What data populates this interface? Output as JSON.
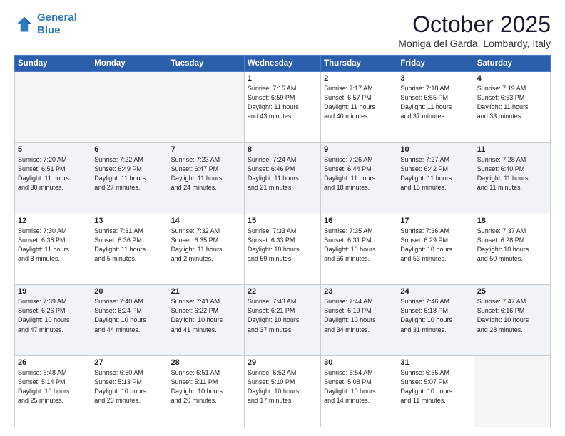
{
  "header": {
    "logo_line1": "General",
    "logo_line2": "Blue",
    "month": "October 2025",
    "location": "Moniga del Garda, Lombardy, Italy"
  },
  "weekdays": [
    "Sunday",
    "Monday",
    "Tuesday",
    "Wednesday",
    "Thursday",
    "Friday",
    "Saturday"
  ],
  "weeks": [
    [
      {
        "day": "",
        "info": ""
      },
      {
        "day": "",
        "info": ""
      },
      {
        "day": "",
        "info": ""
      },
      {
        "day": "1",
        "info": "Sunrise: 7:15 AM\nSunset: 6:59 PM\nDaylight: 11 hours\nand 43 minutes."
      },
      {
        "day": "2",
        "info": "Sunrise: 7:17 AM\nSunset: 6:57 PM\nDaylight: 11 hours\nand 40 minutes."
      },
      {
        "day": "3",
        "info": "Sunrise: 7:18 AM\nSunset: 6:55 PM\nDaylight: 11 hours\nand 37 minutes."
      },
      {
        "day": "4",
        "info": "Sunrise: 7:19 AM\nSunset: 6:53 PM\nDaylight: 11 hours\nand 33 minutes."
      }
    ],
    [
      {
        "day": "5",
        "info": "Sunrise: 7:20 AM\nSunset: 6:51 PM\nDaylight: 11 hours\nand 30 minutes."
      },
      {
        "day": "6",
        "info": "Sunrise: 7:22 AM\nSunset: 6:49 PM\nDaylight: 11 hours\nand 27 minutes."
      },
      {
        "day": "7",
        "info": "Sunrise: 7:23 AM\nSunset: 6:47 PM\nDaylight: 11 hours\nand 24 minutes."
      },
      {
        "day": "8",
        "info": "Sunrise: 7:24 AM\nSunset: 6:46 PM\nDaylight: 11 hours\nand 21 minutes."
      },
      {
        "day": "9",
        "info": "Sunrise: 7:26 AM\nSunset: 6:44 PM\nDaylight: 11 hours\nand 18 minutes."
      },
      {
        "day": "10",
        "info": "Sunrise: 7:27 AM\nSunset: 6:42 PM\nDaylight: 11 hours\nand 15 minutes."
      },
      {
        "day": "11",
        "info": "Sunrise: 7:28 AM\nSunset: 6:40 PM\nDaylight: 11 hours\nand 11 minutes."
      }
    ],
    [
      {
        "day": "12",
        "info": "Sunrise: 7:30 AM\nSunset: 6:38 PM\nDaylight: 11 hours\nand 8 minutes."
      },
      {
        "day": "13",
        "info": "Sunrise: 7:31 AM\nSunset: 6:36 PM\nDaylight: 11 hours\nand 5 minutes."
      },
      {
        "day": "14",
        "info": "Sunrise: 7:32 AM\nSunset: 6:35 PM\nDaylight: 11 hours\nand 2 minutes."
      },
      {
        "day": "15",
        "info": "Sunrise: 7:33 AM\nSunset: 6:33 PM\nDaylight: 10 hours\nand 59 minutes."
      },
      {
        "day": "16",
        "info": "Sunrise: 7:35 AM\nSunset: 6:31 PM\nDaylight: 10 hours\nand 56 minutes."
      },
      {
        "day": "17",
        "info": "Sunrise: 7:36 AM\nSunset: 6:29 PM\nDaylight: 10 hours\nand 53 minutes."
      },
      {
        "day": "18",
        "info": "Sunrise: 7:37 AM\nSunset: 6:28 PM\nDaylight: 10 hours\nand 50 minutes."
      }
    ],
    [
      {
        "day": "19",
        "info": "Sunrise: 7:39 AM\nSunset: 6:26 PM\nDaylight: 10 hours\nand 47 minutes."
      },
      {
        "day": "20",
        "info": "Sunrise: 7:40 AM\nSunset: 6:24 PM\nDaylight: 10 hours\nand 44 minutes."
      },
      {
        "day": "21",
        "info": "Sunrise: 7:41 AM\nSunset: 6:22 PM\nDaylight: 10 hours\nand 41 minutes."
      },
      {
        "day": "22",
        "info": "Sunrise: 7:43 AM\nSunset: 6:21 PM\nDaylight: 10 hours\nand 37 minutes."
      },
      {
        "day": "23",
        "info": "Sunrise: 7:44 AM\nSunset: 6:19 PM\nDaylight: 10 hours\nand 34 minutes."
      },
      {
        "day": "24",
        "info": "Sunrise: 7:46 AM\nSunset: 6:18 PM\nDaylight: 10 hours\nand 31 minutes."
      },
      {
        "day": "25",
        "info": "Sunrise: 7:47 AM\nSunset: 6:16 PM\nDaylight: 10 hours\nand 28 minutes."
      }
    ],
    [
      {
        "day": "26",
        "info": "Sunrise: 6:48 AM\nSunset: 5:14 PM\nDaylight: 10 hours\nand 25 minutes."
      },
      {
        "day": "27",
        "info": "Sunrise: 6:50 AM\nSunset: 5:13 PM\nDaylight: 10 hours\nand 23 minutes."
      },
      {
        "day": "28",
        "info": "Sunrise: 6:51 AM\nSunset: 5:11 PM\nDaylight: 10 hours\nand 20 minutes."
      },
      {
        "day": "29",
        "info": "Sunrise: 6:52 AM\nSunset: 5:10 PM\nDaylight: 10 hours\nand 17 minutes."
      },
      {
        "day": "30",
        "info": "Sunrise: 6:54 AM\nSunset: 5:08 PM\nDaylight: 10 hours\nand 14 minutes."
      },
      {
        "day": "31",
        "info": "Sunrise: 6:55 AM\nSunset: 5:07 PM\nDaylight: 10 hours\nand 11 minutes."
      },
      {
        "day": "",
        "info": ""
      }
    ]
  ]
}
